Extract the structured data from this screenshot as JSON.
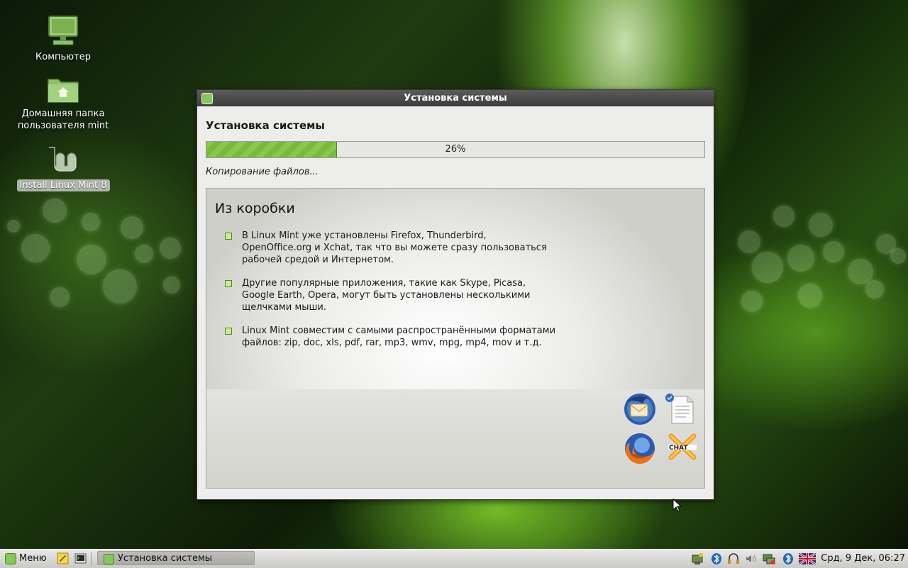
{
  "desktop": {
    "icons": [
      {
        "label": "Компьютер"
      },
      {
        "label": "Домашняя папка пользователя mint"
      },
      {
        "label": "Install Linux Mint 8"
      }
    ]
  },
  "window": {
    "title": "Установка системы",
    "heading": "Установка системы",
    "progress": {
      "percent": 26,
      "text": "26%"
    },
    "status": "Копирование файлов...",
    "slide": {
      "title": "Из коробки",
      "bullets": [
        "В Linux Mint уже установлены Firefox, Thunderbird, OpenOffice.org и Xchat, так что вы можете сразу пользоваться рабочей средой и Интернетом.",
        "Другие популярные приложения, такие как Skype, Picasa, Google Earth, Opera, могут быть установлены несколькими щелчками мыши.",
        "Linux Mint совместим с самыми распространёнными форматами файлов: zip, doc, xls, pdf, rar, mp3, wmv, mpg, mp4, mov и т.д."
      ],
      "app_icons": [
        "thunderbird-icon",
        "openoffice-writer-icon",
        "firefox-icon",
        "xchat-icon"
      ]
    }
  },
  "taskbar": {
    "menu_label": "Меню",
    "task_label": "Установка системы",
    "clock": "Срд,  9 Дек, 06:27",
    "tray_icons": [
      "network-icon",
      "bluetooth-icon",
      "headset-icon",
      "volume-icon",
      "network-manager-icon",
      "bluetooth-icon",
      "keyboard-layout-flag-icon"
    ]
  },
  "colors": {
    "accent_green": "#86c65a",
    "progress_green": "#8bc64e",
    "titlebar": "#4a4a4a"
  }
}
